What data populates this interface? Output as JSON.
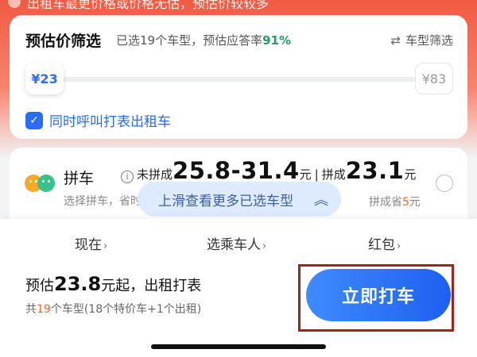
{
  "banner": {
    "text": "出租车最更价格或价格无估，预估价较较多"
  },
  "filter": {
    "title": "预估价筛选",
    "subtitle_prefix": "已选19个车型，预估应答率",
    "rate": "91%",
    "filter_icon": "swap-arrows-icon",
    "filter_label": "车型筛选",
    "slider": {
      "min_label": "¥23",
      "max_label": "¥83",
      "min_value": 23,
      "max_value": 83
    },
    "checkbox_checked": true,
    "checkbox_label": "同时呼叫打表出租车"
  },
  "carpool": {
    "name": "拼车",
    "desc": "选择拼车，省时",
    "unmatched_label": "未拼成",
    "unmatched_price": "25.8-31.4",
    "unit": "元",
    "separator": "|",
    "matched_label": "拼成",
    "matched_price": "23.1",
    "save_prefix": "拼成省",
    "save_value": "5",
    "save_unit": "元",
    "selected": false
  },
  "swipe_hint": {
    "text": "上滑查看更多已选车型",
    "icon": "double-chevron-up-icon"
  },
  "options": [
    {
      "label": "现在"
    },
    {
      "label": "选乘车人"
    },
    {
      "label": "红包"
    }
  ],
  "estimate": {
    "prefix": "预估",
    "price": "23.8",
    "suffix": "元起，出租打表",
    "sub_prefix": "共",
    "sub_count": "19",
    "sub_suffix": "个车型(18个特价车+1个出租)"
  },
  "cta": {
    "label": "立即打车"
  },
  "colors": {
    "accent_blue": "#2b6cf6",
    "rate_green": "#1aa160",
    "highlight_orange": "#f06a2a",
    "annotation_red": "#a2231d"
  }
}
